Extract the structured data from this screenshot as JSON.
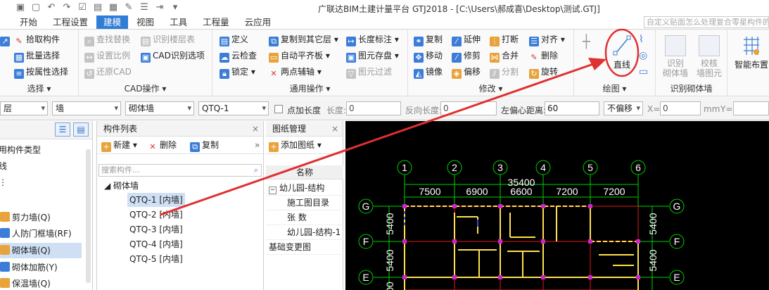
{
  "window": {
    "title": "广联达BIM土建计量平台 GTJ2018 - [C:\\Users\\郝成喜\\Desktop\\测试.GTJ]",
    "search_placeholder": "自定义贴面怎么处理复合零星构件的"
  },
  "menu": {
    "tabs": [
      "开始",
      "工程设置",
      "建模",
      "视图",
      "工具",
      "工程量",
      "云应用"
    ],
    "active": "建模"
  },
  "ribbon": {
    "select_group": {
      "title": "选择",
      "items": [
        "拾取构件",
        "批量选择",
        "按属性选择"
      ]
    },
    "cad_group": {
      "title": "CAD操作",
      "col1": [
        "查找替换",
        "设置比例",
        "还原CAD"
      ],
      "col2": [
        "识别楼层表",
        "CAD识别选项"
      ]
    },
    "common_group": {
      "title": "通用操作",
      "col1": [
        "定义",
        "云检查",
        "锁定"
      ],
      "col2": [
        "复制到其它层",
        "自动平齐板",
        "两点辅轴"
      ],
      "col3": [
        "长度标注",
        "图元存盘",
        "图元过滤"
      ]
    },
    "modify_group": {
      "title": "修改",
      "col1": [
        "复制",
        "移动",
        "镜像"
      ],
      "col2": [
        "延伸",
        "修剪",
        "偏移"
      ],
      "col3": [
        "打断",
        "合并",
        "分割"
      ],
      "col4": [
        "对齐",
        "删除",
        "旋转"
      ]
    },
    "draw_group": {
      "title": "绘图",
      "line_label": "直线"
    },
    "identify_group": {
      "title": "识别砌体墙",
      "btn1": [
        "识别",
        "砌体墙"
      ],
      "btn2": [
        "校核",
        "墙图元"
      ]
    },
    "smart_layout_label": "智能布置"
  },
  "property_toolbar": {
    "floor_combo": "层",
    "type_combo": "墙",
    "subtype_combo": "砌体墙",
    "component_combo": "QTQ-1",
    "point_length_label": "点加长度",
    "length_label": "长度:",
    "length_value": "0",
    "reverse_length_label": "反向长度:",
    "reverse_length_value": "0",
    "left_offset_label": "左偏心距离:",
    "left_offset_value": "60",
    "offset_combo": "不偏移",
    "x_label": "X=",
    "x_value": "0",
    "mm_label": "mm",
    "y_label": "Y="
  },
  "left_panel": {
    "items": [
      {
        "label": "用构件类型",
        "selected": false
      },
      {
        "label": "线",
        "selected": false
      },
      {
        "label": "",
        "selected": false
      },
      {
        "label": "剪力墙(Q)",
        "selected": false
      },
      {
        "label": "人防门框墙(RF)",
        "selected": false
      },
      {
        "label": "砌体墙(Q)",
        "selected": true
      },
      {
        "label": "砌体加筋(Y)",
        "selected": false
      },
      {
        "label": "保温墙(Q)",
        "selected": false
      }
    ]
  },
  "component_list": {
    "title": "构件列表",
    "new_label": "新建",
    "delete_label": "删除",
    "copy_label": "复制",
    "search_placeholder": "搜索构件...",
    "group": "砌体墙",
    "items": [
      "QTQ-1 [内墙]",
      "QTQ-2 [内墙]",
      "QTQ-3 [内墙]",
      "QTQ-4 [内墙]",
      "QTQ-5 [内墙]"
    ],
    "selected": "QTQ-1 [内墙]"
  },
  "drawing_panel": {
    "title": "图纸管理",
    "add_label": "添加图纸",
    "col_header": "名称",
    "rows": [
      "幼儿园-结构",
      "施工图目录",
      "张 数",
      "幼儿园-结构-1",
      "基础变更图"
    ]
  },
  "cad": {
    "axis_numbers": [
      "1",
      "2",
      "3",
      "4",
      "5",
      "6"
    ],
    "axis_letters_left": [
      "G",
      "F",
      "E"
    ],
    "axis_letters_right": [
      "G",
      "F",
      "E"
    ],
    "total_dim": "35400",
    "span_dims": [
      "7500",
      "6900",
      "6600",
      "7200",
      "7200"
    ],
    "vertical_dims": [
      "5400",
      "5400"
    ],
    "right_dims": [
      "5400",
      "5400"
    ],
    "bottom_left_text": "00"
  },
  "colors": {
    "accent": "#2f7dd6",
    "annotation": "#e03030",
    "cad_green": "#00d000",
    "cad_yellow": "#ffe14a",
    "cad_red": "#e01818",
    "cad_magenta": "#d020d0"
  }
}
